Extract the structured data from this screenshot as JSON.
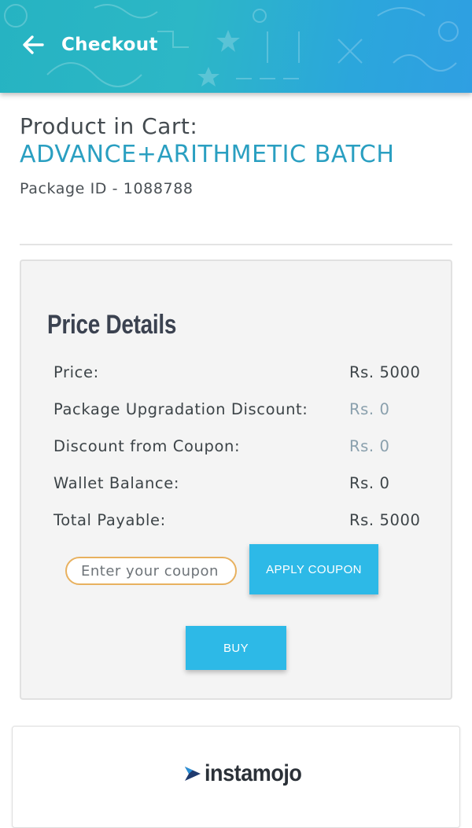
{
  "header": {
    "title": "Checkout",
    "back_icon": "arrow-left-icon",
    "gradient_start": "#26b3c2",
    "gradient_end": "#2f9fe2"
  },
  "product": {
    "label": "Product in Cart:",
    "name": "ADVANCE+ARITHMETIC BATCH",
    "package_id": "Package ID - 1088788"
  },
  "price_details": {
    "heading": "Price Details",
    "rows": [
      {
        "label": "Price:",
        "value": "Rs. 5000",
        "muted": false
      },
      {
        "label": "Package Upgradation Discount:",
        "value": "Rs. 0",
        "muted": true
      },
      {
        "label": "Discount from Coupon:",
        "value": "Rs. 0",
        "muted": true
      },
      {
        "label": "Wallet Balance:",
        "value": "Rs. 0",
        "muted": false
      },
      {
        "label": "Total Payable:",
        "value": "Rs. 5000",
        "muted": false
      }
    ],
    "coupon": {
      "placeholder": "Enter your coupon",
      "value": ""
    },
    "apply_label": "APPLY COUPON",
    "buy_label": "BUY"
  },
  "payment": {
    "provider": "instamojo",
    "logo_icon": "instamojo-logo-icon"
  },
  "colors": {
    "accent": "#2db9e7",
    "product_name": "#2a9fc1",
    "coupon_border": "#e8b15f"
  }
}
